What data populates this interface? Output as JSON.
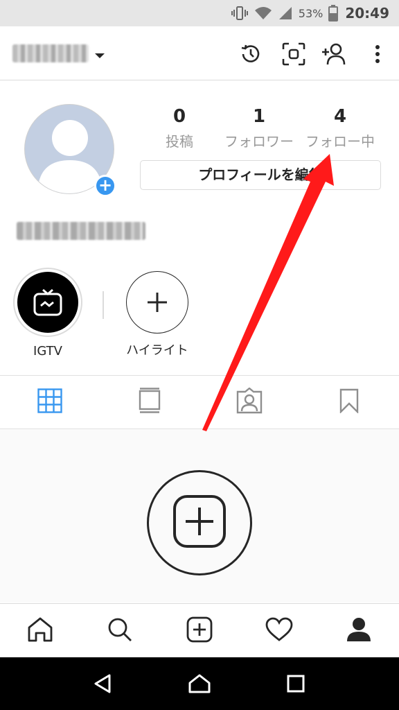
{
  "status_bar": {
    "battery_percent": "53%",
    "time": "20:49",
    "icons": [
      "vibrate-icon",
      "wifi-icon",
      "signal-icon",
      "battery-icon"
    ]
  },
  "top_bar": {
    "username": "",
    "icons": [
      "dropdown-caret-icon",
      "history-icon",
      "scan-icon",
      "add-user-icon",
      "more-icon"
    ]
  },
  "profile": {
    "stats": [
      {
        "value": "0",
        "label": "投稿"
      },
      {
        "value": "1",
        "label": "フォロワー"
      },
      {
        "value": "4",
        "label": "フォロー中"
      }
    ],
    "edit_button_label": "プロフィールを編集",
    "full_name": ""
  },
  "highlights": [
    {
      "label": "IGTV",
      "icon": "igtv-icon"
    },
    {
      "label": "ハイライト",
      "icon": "plus-icon"
    }
  ],
  "tabs": [
    {
      "name": "grid",
      "icon": "grid-icon",
      "active": true
    },
    {
      "name": "feed",
      "icon": "feed-icon",
      "active": false
    },
    {
      "name": "tagged",
      "icon": "tagged-icon",
      "active": false
    },
    {
      "name": "saved",
      "icon": "bookmark-icon",
      "active": false
    }
  ],
  "bottom_nav": [
    "home-icon",
    "search-icon",
    "new-post-icon",
    "heart-icon",
    "profile-icon"
  ],
  "colors": {
    "accent": "#3897f0",
    "annotation_arrow": "#ff1a1a"
  }
}
